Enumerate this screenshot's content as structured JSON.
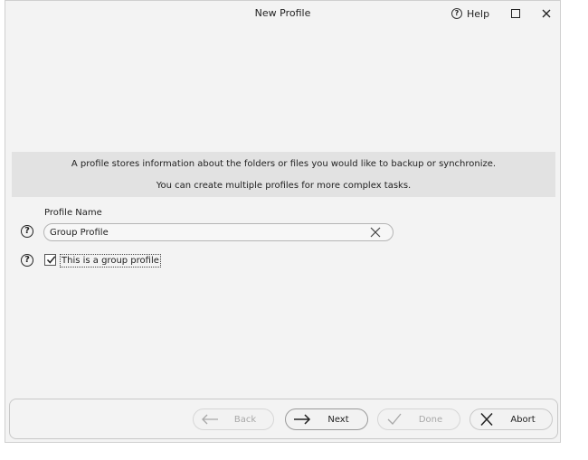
{
  "window": {
    "title": "New Profile",
    "help_label": "Help"
  },
  "info": {
    "line1": "A profile stores information about the folders or files you would like to backup or synchronize.",
    "line2": "You can create multiple profiles for more complex tasks."
  },
  "form": {
    "profile_name_label": "Profile Name",
    "profile_name_value": "Group Profile",
    "group_checkbox_label": "This is a group profile",
    "group_checkbox_checked": true
  },
  "footer": {
    "back_label": "Back",
    "next_label": "Next",
    "done_label": "Done",
    "abort_label": "Abort"
  },
  "icons": {
    "help": "question-circle-icon",
    "maximize": "maximize-icon",
    "close": "close-icon",
    "clear": "clear-x-icon",
    "check": "checkmark-icon",
    "back": "arrow-left-icon",
    "next": "arrow-right-icon",
    "done": "checkmark-icon",
    "abort": "x-icon"
  }
}
